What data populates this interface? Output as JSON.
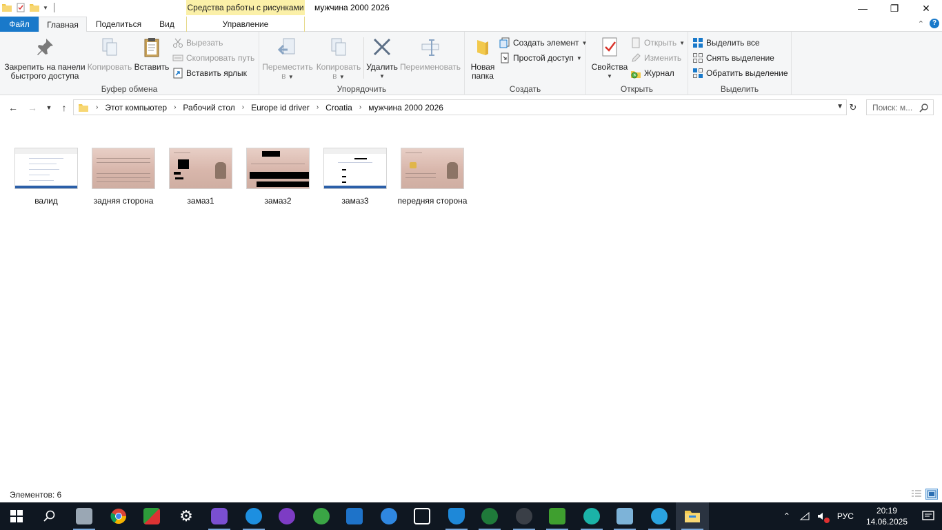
{
  "window": {
    "title": "мужчина 2000 2026",
    "contextual_tab_title": "Средства работы с рисунками",
    "controls": {
      "minimize": "—",
      "maximize": "❐",
      "close": "✕"
    }
  },
  "ribbon_tabs": {
    "file": "Файл",
    "home": "Главная",
    "share": "Поделиться",
    "view": "Вид",
    "manage": "Управление"
  },
  "ribbon": {
    "clipboard": {
      "label": "Буфер обмена",
      "pin": "Закрепить на панели быстрого доступа",
      "pin_line1": "Закрепить на панели",
      "pin_line2": "быстрого доступа",
      "copy": "Копировать",
      "paste": "Вставить",
      "cut": "Вырезать",
      "copy_path": "Скопировать путь",
      "paste_shortcut": "Вставить ярлык"
    },
    "organize": {
      "label": "Упорядочить",
      "move_to_line1": "Переместить",
      "move_to_line2": "в",
      "copy_to_line1": "Копировать",
      "copy_to_line2": "в",
      "delete": "Удалить",
      "rename": "Переименовать"
    },
    "create": {
      "label": "Создать",
      "new_folder_line1": "Новая",
      "new_folder_line2": "папка",
      "new_item": "Создать элемент",
      "easy_access": "Простой доступ"
    },
    "open": {
      "label": "Открыть",
      "properties": "Свойства",
      "open": "Открыть",
      "edit": "Изменить",
      "history": "Журнал"
    },
    "select": {
      "label": "Выделить",
      "select_all": "Выделить все",
      "select_none": "Снять выделение",
      "invert": "Обратить выделение"
    }
  },
  "address": {
    "breadcrumbs": [
      "Этот компьютер",
      "Рабочий стол",
      "Europe id driver",
      "Croatia",
      "мужчина 2000 2026"
    ],
    "search_placeholder": "Поиск: м..."
  },
  "files": [
    {
      "name": "валид",
      "kind": "screen"
    },
    {
      "name": "задняя сторона",
      "kind": "card-back"
    },
    {
      "name": "замаз1",
      "kind": "card-redacted"
    },
    {
      "name": "замаз2",
      "kind": "card-redacted2"
    },
    {
      "name": "замаз3",
      "kind": "screen-redacted"
    },
    {
      "name": "передняя сторона",
      "kind": "card-front"
    }
  ],
  "status": {
    "items_count": "Элементов: 6"
  },
  "taskbar": {
    "language": "РУС",
    "time": "20:19",
    "date": "14.06.2025",
    "apps": [
      "start-icon",
      "search-icon",
      "app-icon",
      "chrome-icon",
      "app-icon",
      "settings-icon",
      "app-icon",
      "app-icon",
      "tor-icon",
      "utorrent-icon",
      "photos-icon",
      "app-icon",
      "app-icon",
      "shield-icon",
      "app-icon",
      "app-icon",
      "lock-icon",
      "app-icon",
      "app-icon",
      "telegram-icon",
      "explorer-icon"
    ]
  },
  "colors": {
    "file_tab": "#1979ca",
    "contextual": "#fbf0a8",
    "taskbar": "#0f1721",
    "accent": "#1979ca"
  }
}
